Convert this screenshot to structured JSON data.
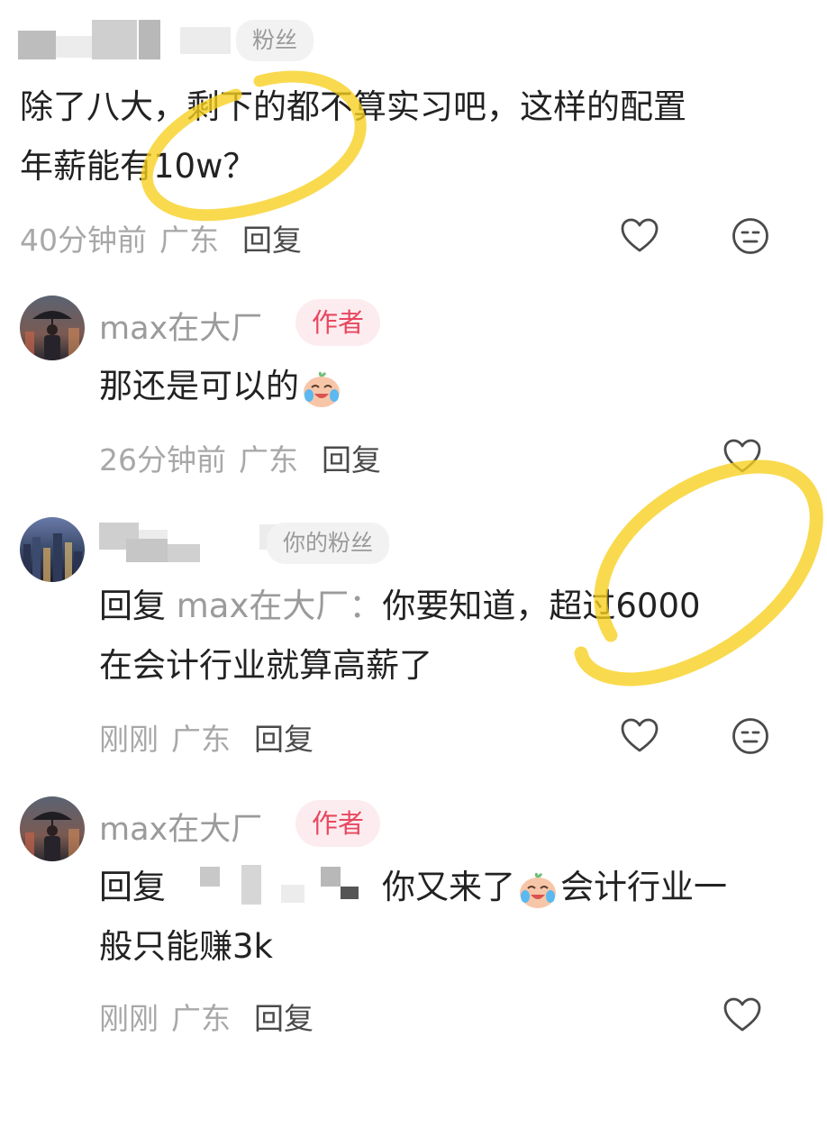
{
  "comments": [
    {
      "fan_tag": "粉丝",
      "text_line1": "除了八大，剩下的都不算实习吧，这样的配置",
      "text_line2": "年薪能有10w？",
      "time": "40分钟前",
      "location": "广东",
      "reply_label": "回复"
    },
    {
      "username": "max在大厂",
      "badge": "作者",
      "text": "那还是可以的",
      "time": "26分钟前",
      "location": "广东",
      "reply_label": "回复"
    },
    {
      "fan_tag": "你的粉丝",
      "reply_prefix": "回复",
      "reply_to": "max在大厂：",
      "text_line1": "你要知道，超过6000",
      "text_line2": "在会计行业就算高薪了",
      "time": "刚刚",
      "location": "广东",
      "reply_label": "回复"
    },
    {
      "username": "max在大厂",
      "badge": "作者",
      "reply_prefix": "回复",
      "text_part1": "你又来了",
      "text_part2": "会计行业一",
      "text_line2": "般只能赚3k",
      "time": "刚刚",
      "location": "广东",
      "reply_label": "回复"
    }
  ],
  "icons": {
    "like": "heart-icon",
    "dislike": "meh-face-icon",
    "emoji": "crying-laughing-emoji"
  },
  "colors": {
    "author_badge_bg": "#fdecef",
    "author_badge_text": "#e8475f",
    "highlight": "#f7cf1c"
  }
}
